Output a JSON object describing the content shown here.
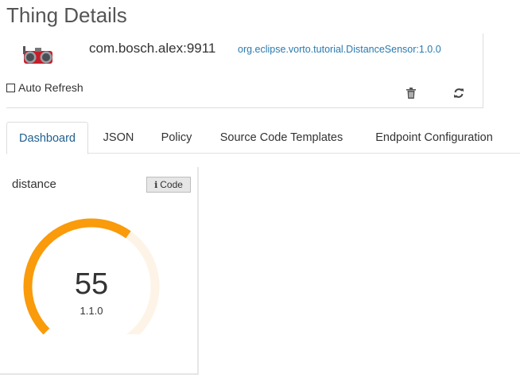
{
  "page": {
    "title": "Thing Details"
  },
  "thing": {
    "id": "com.bosch.alex:9911",
    "model": "org.eclipse.vorto.tutorial.DistanceSensor:1.0.0",
    "auto_refresh_label": "Auto Refresh",
    "auto_refresh_checked": false,
    "image_icon": "distance-sensor-image"
  },
  "tabs": [
    {
      "label": "Dashboard",
      "active": true
    },
    {
      "label": "JSON",
      "active": false
    },
    {
      "label": "Policy",
      "active": false
    },
    {
      "label": "Source Code Templates",
      "active": false
    },
    {
      "label": "Endpoint Configuration",
      "active": false
    }
  ],
  "widget": {
    "title": "distance",
    "code_button_label": "Code",
    "gauge": {
      "value": "55",
      "version": "1.1.0",
      "fill_fraction": 0.55,
      "color_fill": "#f99b0a",
      "color_track": "#fdf4e7"
    }
  },
  "colors": {
    "accent": "#1f5f8e",
    "link": "#2a7ab0"
  }
}
